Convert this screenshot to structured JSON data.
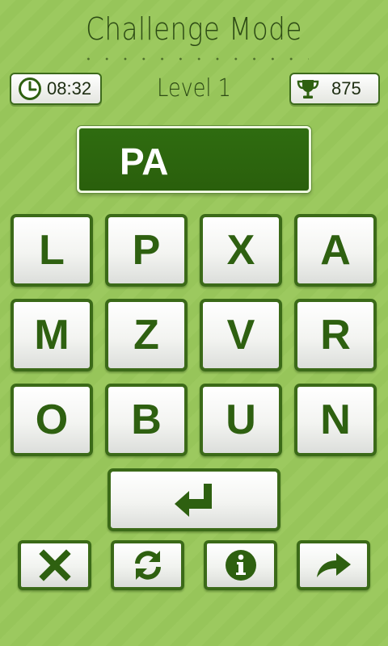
{
  "header": {
    "title": "Challenge Mode",
    "timer": "08:32",
    "level": "Level 1",
    "score": "875"
  },
  "answer": "PA",
  "letters": [
    "L",
    "P",
    "X",
    "A",
    "M",
    "Z",
    "V",
    "R",
    "O",
    "B",
    "U",
    "N"
  ],
  "icons": {
    "timer": "clock-icon",
    "score": "trophy-icon",
    "enter": "enter-arrow-icon",
    "clear": "close-icon",
    "shuffle": "refresh-icon",
    "info": "info-icon",
    "skip": "forward-arrow-icon"
  },
  "colors": {
    "background": "#9cc95f",
    "accent": "#2e6010",
    "answer_bg": "#2f6c10"
  }
}
